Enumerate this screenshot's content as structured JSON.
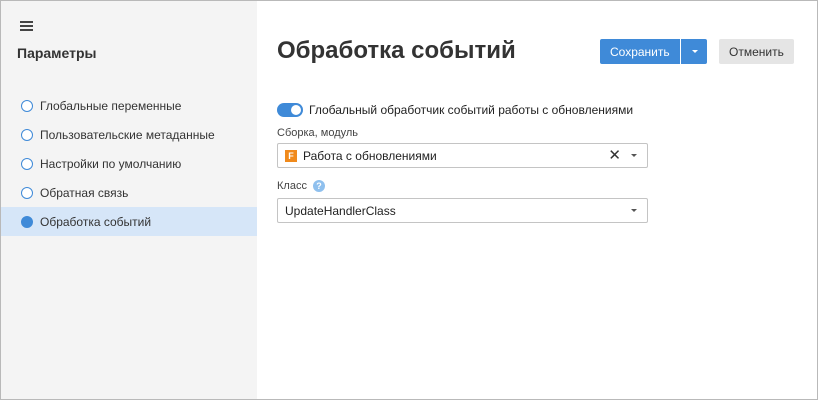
{
  "sidebar": {
    "menu_icon": "hamburger-icon",
    "title": "Параметры",
    "items": [
      {
        "label": "Глобальные переменные",
        "active": false
      },
      {
        "label": "Пользовательские метаданные",
        "active": false
      },
      {
        "label": "Настройки по умолчанию",
        "active": false
      },
      {
        "label": "Обратная связь",
        "active": false
      },
      {
        "label": "Обработка событий",
        "active": true
      }
    ]
  },
  "main": {
    "title": "Обработка событий",
    "save_label": "Сохранить",
    "cancel_label": "Отменить",
    "toggle": {
      "label": "Глобальный обработчик событий работы с обновлениями",
      "on": true
    },
    "assembly": {
      "label": "Сборка, модуль",
      "value": "Работа с обновлениями",
      "icon_letter": "F",
      "icon": "module-icon"
    },
    "class_field": {
      "label": "Класс",
      "help_icon": "?",
      "value": "UpdateHandlerClass"
    }
  },
  "colors": {
    "accent": "#3f8ad8",
    "sidebar_bg": "#f4f4f4",
    "active_item_bg": "#d6e6f8",
    "module_icon": "#f08a1c"
  }
}
